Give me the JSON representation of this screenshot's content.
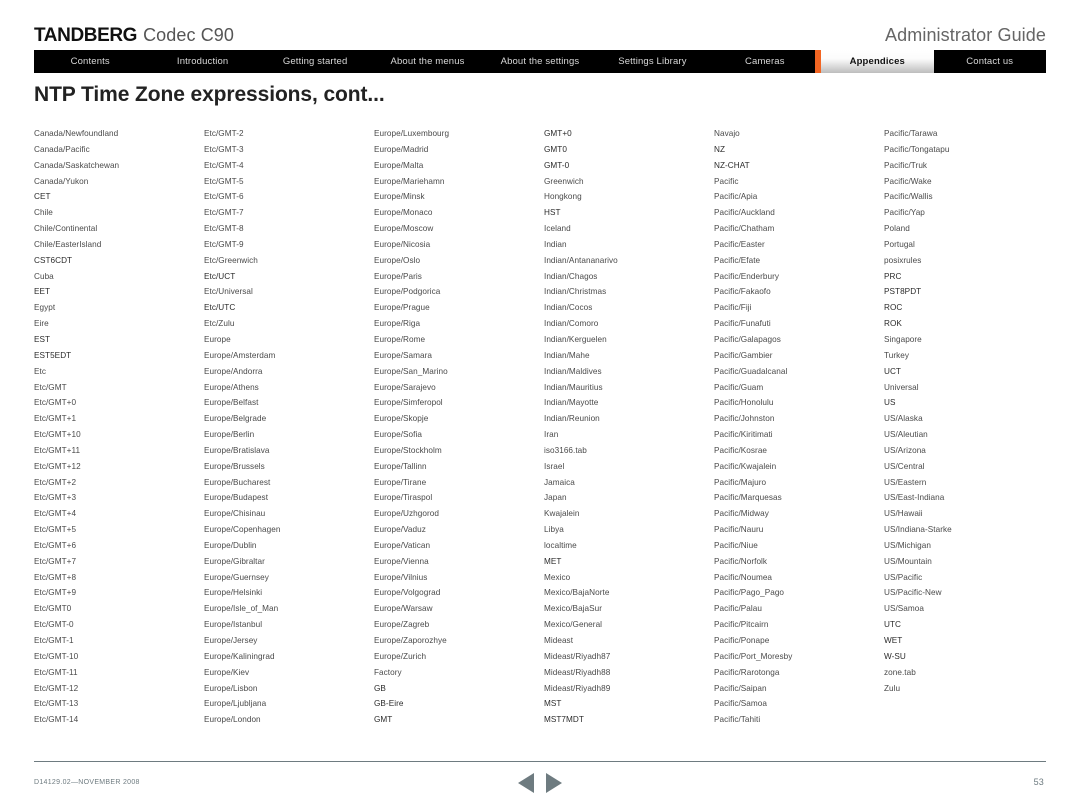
{
  "header": {
    "brand_logo": "TANDBERG",
    "brand_model": "Codec C90",
    "guide_title": "Administrator Guide"
  },
  "nav": {
    "items": [
      {
        "label": "Contents",
        "active": false
      },
      {
        "label": "Introduction",
        "active": false
      },
      {
        "label": "Getting started",
        "active": false
      },
      {
        "label": "About the menus",
        "active": false
      },
      {
        "label": "About the settings",
        "active": false
      },
      {
        "label": "Settings Library",
        "active": false
      },
      {
        "label": "Cameras",
        "active": false
      },
      {
        "label": "Appendices",
        "active": true
      },
      {
        "label": "Contact us",
        "active": false
      }
    ],
    "accent_color": "#f26522",
    "bar_color": "#000000"
  },
  "page_title": "NTP Time Zone expressions, cont...",
  "columns": [
    [
      "Canada/Newfoundland",
      "Canada/Pacific",
      "Canada/Saskatchewan",
      "Canada/Yukon",
      "CET",
      "Chile",
      "Chile/Continental",
      "Chile/EasterIsland",
      "CST6CDT",
      "Cuba",
      "EET",
      "Egypt",
      "Eire",
      "EST",
      "EST5EDT",
      "Etc",
      "Etc/GMT",
      "Etc/GMT+0",
      "Etc/GMT+1",
      "Etc/GMT+10",
      "Etc/GMT+11",
      "Etc/GMT+12",
      "Etc/GMT+2",
      "Etc/GMT+3",
      "Etc/GMT+4",
      "Etc/GMT+5",
      "Etc/GMT+6",
      "Etc/GMT+7",
      "Etc/GMT+8",
      "Etc/GMT+9",
      "Etc/GMT0",
      "Etc/GMT-0",
      "Etc/GMT-1",
      "Etc/GMT-10",
      "Etc/GMT-11",
      "Etc/GMT-12",
      "Etc/GMT-13",
      "Etc/GMT-14"
    ],
    [
      "Etc/GMT-2",
      "Etc/GMT-3",
      "Etc/GMT-4",
      "Etc/GMT-5",
      "Etc/GMT-6",
      "Etc/GMT-7",
      "Etc/GMT-8",
      "Etc/GMT-9",
      "Etc/Greenwich",
      "Etc/UCT",
      "Etc/Universal",
      "Etc/UTC",
      "Etc/Zulu",
      "Europe",
      "Europe/Amsterdam",
      "Europe/Andorra",
      "Europe/Athens",
      "Europe/Belfast",
      "Europe/Belgrade",
      "Europe/Berlin",
      "Europe/Bratislava",
      "Europe/Brussels",
      "Europe/Bucharest",
      "Europe/Budapest",
      "Europe/Chisinau",
      "Europe/Copenhagen",
      "Europe/Dublin",
      "Europe/Gibraltar",
      "Europe/Guernsey",
      "Europe/Helsinki",
      "Europe/Isle_of_Man",
      "Europe/Istanbul",
      "Europe/Jersey",
      "Europe/Kaliningrad",
      "Europe/Kiev",
      "Europe/Lisbon",
      "Europe/Ljubljana",
      "Europe/London"
    ],
    [
      "Europe/Luxembourg",
      "Europe/Madrid",
      "Europe/Malta",
      "Europe/Mariehamn",
      "Europe/Minsk",
      "Europe/Monaco",
      "Europe/Moscow",
      "Europe/Nicosia",
      "Europe/Oslo",
      "Europe/Paris",
      "Europe/Podgorica",
      "Europe/Prague",
      "Europe/Riga",
      "Europe/Rome",
      "Europe/Samara",
      "Europe/San_Marino",
      "Europe/Sarajevo",
      "Europe/Simferopol",
      "Europe/Skopje",
      "Europe/Sofia",
      "Europe/Stockholm",
      "Europe/Tallinn",
      "Europe/Tirane",
      "Europe/Tiraspol",
      "Europe/Uzhgorod",
      "Europe/Vaduz",
      "Europe/Vatican",
      "Europe/Vienna",
      "Europe/Vilnius",
      "Europe/Volgograd",
      "Europe/Warsaw",
      "Europe/Zagreb",
      "Europe/Zaporozhye",
      "Europe/Zurich",
      "Factory",
      "GB",
      "GB-Eire",
      "GMT"
    ],
    [
      "GMT+0",
      "GMT0",
      "GMT-0",
      "Greenwich",
      "Hongkong",
      "HST",
      "Iceland",
      "Indian",
      "Indian/Antananarivo",
      "Indian/Chagos",
      "Indian/Christmas",
      "Indian/Cocos",
      "Indian/Comoro",
      "Indian/Kerguelen",
      "Indian/Mahe",
      "Indian/Maldives",
      "Indian/Mauritius",
      "Indian/Mayotte",
      "Indian/Reunion",
      "Iran",
      "iso3166.tab",
      "Israel",
      "Jamaica",
      "Japan",
      "Kwajalein",
      "Libya",
      "localtime",
      "MET",
      "Mexico",
      "Mexico/BajaNorte",
      "Mexico/BajaSur",
      "Mexico/General",
      "Mideast",
      "Mideast/Riyadh87",
      "Mideast/Riyadh88",
      "Mideast/Riyadh89",
      "MST",
      "MST7MDT"
    ],
    [
      "Navajo",
      "NZ",
      "NZ-CHAT",
      "Pacific",
      "Pacific/Apia",
      "Pacific/Auckland",
      "Pacific/Chatham",
      "Pacific/Easter",
      "Pacific/Efate",
      "Pacific/Enderbury",
      "Pacific/Fakaofo",
      "Pacific/Fiji",
      "Pacific/Funafuti",
      "Pacific/Galapagos",
      "Pacific/Gambier",
      "Pacific/Guadalcanal",
      "Pacific/Guam",
      "Pacific/Honolulu",
      "Pacific/Johnston",
      "Pacific/Kiritimati",
      "Pacific/Kosrae",
      "Pacific/Kwajalein",
      "Pacific/Majuro",
      "Pacific/Marquesas",
      "Pacific/Midway",
      "Pacific/Nauru",
      "Pacific/Niue",
      "Pacific/Norfolk",
      "Pacific/Noumea",
      "Pacific/Pago_Pago",
      "Pacific/Palau",
      "Pacific/Pitcairn",
      "Pacific/Ponape",
      "Pacific/Port_Moresby",
      "Pacific/Rarotonga",
      "Pacific/Saipan",
      "Pacific/Samoa",
      "Pacific/Tahiti"
    ],
    [
      "Pacific/Tarawa",
      "Pacific/Tongatapu",
      "Pacific/Truk",
      "Pacific/Wake",
      "Pacific/Wallis",
      "Pacific/Yap",
      "Poland",
      "Portugal",
      "posixrules",
      "PRC",
      "PST8PDT",
      "ROC",
      "ROK",
      "Singapore",
      "Turkey",
      "UCT",
      "Universal",
      "US",
      "US/Alaska",
      "US/Aleutian",
      "US/Arizona",
      "US/Central",
      "US/Eastern",
      "US/East-Indiana",
      "US/Hawaii",
      "US/Indiana-Starke",
      "US/Michigan",
      "US/Mountain",
      "US/Pacific",
      "US/Pacific-New",
      "US/Samoa",
      "UTC",
      "WET",
      "W-SU",
      "zone.tab",
      "Zulu"
    ]
  ],
  "footer": {
    "document_id": "D14129.02—NOVEMBER 2008",
    "page_number": "53",
    "prev_icon": "triangle-left-icon",
    "next_icon": "triangle-right-icon",
    "rule_color": "#6e7b80"
  }
}
